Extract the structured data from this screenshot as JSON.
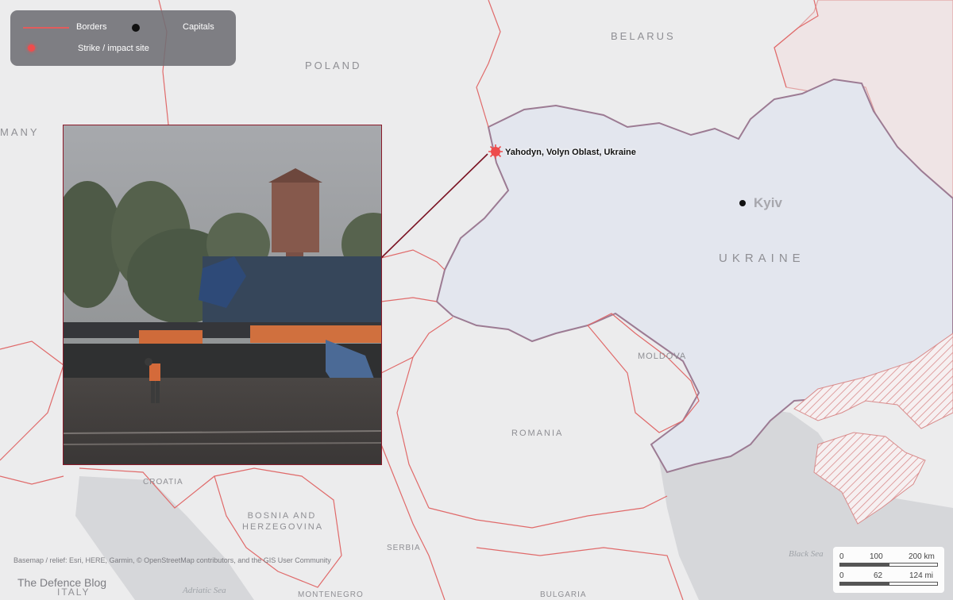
{
  "legend": {
    "borders_label": "Borders",
    "capitals_label": "Capitals",
    "strike_label": "Strike / impact site"
  },
  "colors": {
    "border": "#e06a6a",
    "ukraine_fill": "#e3e6ee",
    "ukraine_border": "#9c7b93",
    "occupied_hatch": "#d98c8c",
    "callout_line": "#7a1222",
    "strike": "#ee4c4c",
    "water": "#d6d7da"
  },
  "labels": {
    "belarus": "BELARUS",
    "poland": "POLAND",
    "germany_partial": "MANY",
    "ukraine": "UKRAINE",
    "moldova": "MOLDOVA",
    "romania": "ROMANIA",
    "bosnia": "BOSNIA AND HERZEGOVINA",
    "croatia_partial": "CROATIA",
    "serbia": "SERBIA",
    "bulgaria": "BULGARIA",
    "montenegro_partial": "MONTENEGRO",
    "italy_partial": "ITALY",
    "black_sea": "Black Sea",
    "adriatic_sea": "Adriatic Sea"
  },
  "capital": {
    "name": "Kyiv"
  },
  "strike_site": {
    "name": "Yahodyn, Volyn Oblast, Ukraine"
  },
  "credit": "Basemap / relief: Esri, HERE, Garmin, © OpenStreetMap contributors, and the GIS User Community",
  "watermark": "The Defence Blog",
  "scale": {
    "km": {
      "zero": "0",
      "mid": "100",
      "end": "200 km"
    },
    "mi": {
      "zero": "0",
      "mid": "62",
      "end": "124 mi"
    }
  }
}
